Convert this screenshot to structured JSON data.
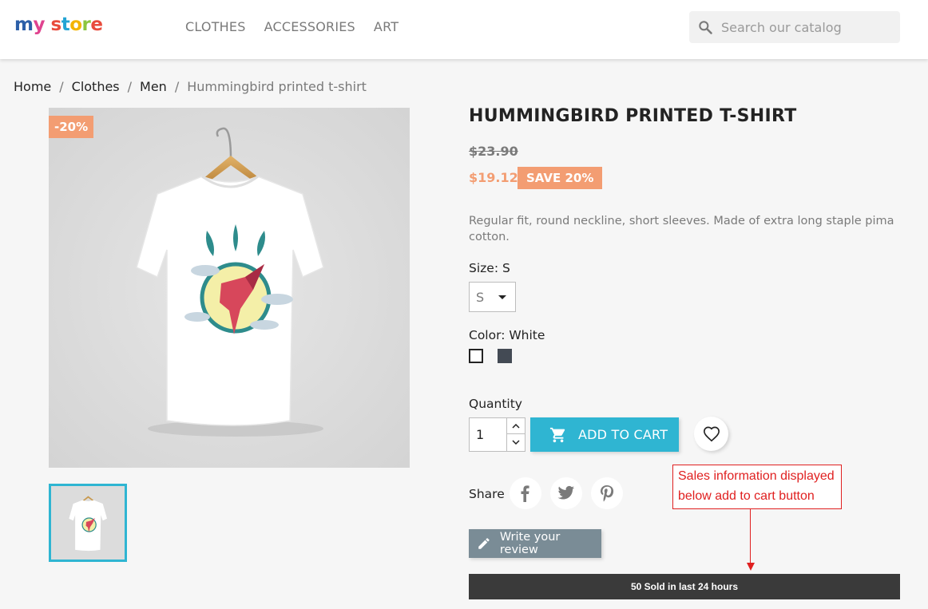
{
  "header": {
    "logo": {
      "part1": "my",
      "part2": "store"
    },
    "nav": [
      "CLOTHES",
      "ACCESSORIES",
      "ART"
    ],
    "search_placeholder": "Search our catalog"
  },
  "breadcrumb": [
    "Home",
    "Clothes",
    "Men",
    "Hummingbird printed t-shirt"
  ],
  "product": {
    "discount_flag": "-20%",
    "title": "HUMMINGBIRD PRINTED T-SHIRT",
    "old_price": "$23.90",
    "price": "$19.12",
    "save_badge": "SAVE 20%",
    "description": "Regular fit, round neckline, short sleeves. Made of extra long staple pima cotton.",
    "size_label": "Size: S",
    "size_value": "S",
    "color_label": "Color: White",
    "colors": [
      "#ffffff",
      "#434a54"
    ],
    "quantity_label": "Quantity",
    "quantity_value": "1",
    "add_to_cart": "ADD TO CART",
    "share_label": "Share",
    "review_button": "Write your review",
    "sold_info": "50 Sold in last 24 hours"
  },
  "annotation": {
    "line1": "Sales information displayed",
    "line2": "below add to cart button"
  },
  "colors": {
    "accent": "#2fb5d2",
    "discount": "#f39d72",
    "annotation": "#e02020"
  }
}
